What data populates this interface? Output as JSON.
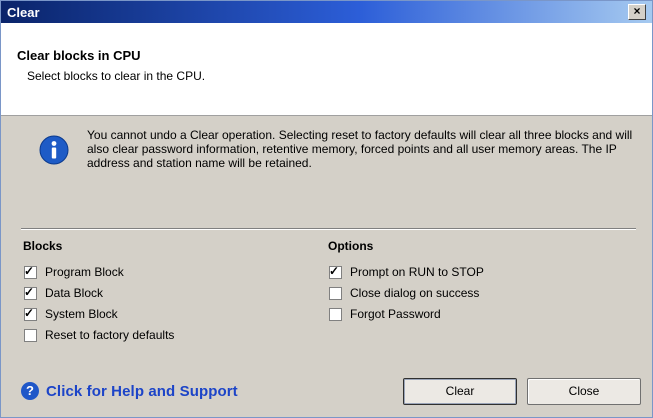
{
  "window": {
    "title": "Clear",
    "close_glyph": "×"
  },
  "header": {
    "title": "Clear blocks in CPU",
    "subtitle": "Select blocks to clear in the CPU."
  },
  "info": {
    "icon": "info-icon",
    "message": "You cannot undo a Clear operation. Selecting reset to factory defaults will clear all three blocks and will also clear password information, retentive memory, forced points and all user memory areas. The IP address and station name will be retained."
  },
  "blocks": {
    "title": "Blocks",
    "items": [
      {
        "label": "Program Block",
        "checked": true
      },
      {
        "label": "Data Block",
        "checked": true
      },
      {
        "label": "System Block",
        "checked": true
      },
      {
        "label": "Reset to factory defaults",
        "checked": false
      }
    ]
  },
  "options": {
    "title": "Options",
    "items": [
      {
        "label": "Prompt on RUN to STOP",
        "checked": true
      },
      {
        "label": "Close dialog on success",
        "checked": false
      },
      {
        "label": "Forgot Password",
        "checked": false
      }
    ]
  },
  "help": {
    "icon": "help-icon",
    "glyph": "?",
    "label": "Click for Help and Support"
  },
  "buttons": {
    "clear": "Clear",
    "close": "Close"
  },
  "check_glyph": "✓",
  "colors": {
    "accent": "#1c44c8",
    "title_bar": "#0a246a"
  }
}
